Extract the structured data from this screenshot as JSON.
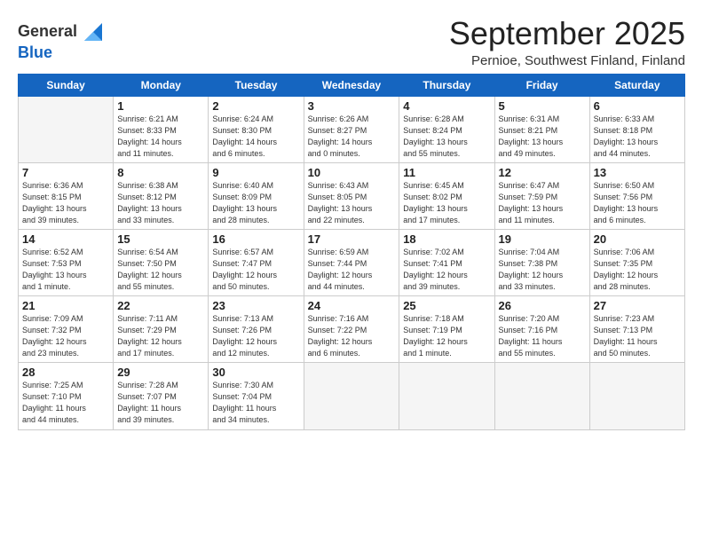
{
  "header": {
    "logo_general": "General",
    "logo_blue": "Blue",
    "month_title": "September 2025",
    "location": "Pernioe, Southwest Finland, Finland"
  },
  "days_of_week": [
    "Sunday",
    "Monday",
    "Tuesday",
    "Wednesday",
    "Thursday",
    "Friday",
    "Saturday"
  ],
  "weeks": [
    [
      {
        "day": "",
        "info": ""
      },
      {
        "day": "1",
        "info": "Sunrise: 6:21 AM\nSunset: 8:33 PM\nDaylight: 14 hours\nand 11 minutes."
      },
      {
        "day": "2",
        "info": "Sunrise: 6:24 AM\nSunset: 8:30 PM\nDaylight: 14 hours\nand 6 minutes."
      },
      {
        "day": "3",
        "info": "Sunrise: 6:26 AM\nSunset: 8:27 PM\nDaylight: 14 hours\nand 0 minutes."
      },
      {
        "day": "4",
        "info": "Sunrise: 6:28 AM\nSunset: 8:24 PM\nDaylight: 13 hours\nand 55 minutes."
      },
      {
        "day": "5",
        "info": "Sunrise: 6:31 AM\nSunset: 8:21 PM\nDaylight: 13 hours\nand 49 minutes."
      },
      {
        "day": "6",
        "info": "Sunrise: 6:33 AM\nSunset: 8:18 PM\nDaylight: 13 hours\nand 44 minutes."
      }
    ],
    [
      {
        "day": "7",
        "info": "Sunrise: 6:36 AM\nSunset: 8:15 PM\nDaylight: 13 hours\nand 39 minutes."
      },
      {
        "day": "8",
        "info": "Sunrise: 6:38 AM\nSunset: 8:12 PM\nDaylight: 13 hours\nand 33 minutes."
      },
      {
        "day": "9",
        "info": "Sunrise: 6:40 AM\nSunset: 8:09 PM\nDaylight: 13 hours\nand 28 minutes."
      },
      {
        "day": "10",
        "info": "Sunrise: 6:43 AM\nSunset: 8:05 PM\nDaylight: 13 hours\nand 22 minutes."
      },
      {
        "day": "11",
        "info": "Sunrise: 6:45 AM\nSunset: 8:02 PM\nDaylight: 13 hours\nand 17 minutes."
      },
      {
        "day": "12",
        "info": "Sunrise: 6:47 AM\nSunset: 7:59 PM\nDaylight: 13 hours\nand 11 minutes."
      },
      {
        "day": "13",
        "info": "Sunrise: 6:50 AM\nSunset: 7:56 PM\nDaylight: 13 hours\nand 6 minutes."
      }
    ],
    [
      {
        "day": "14",
        "info": "Sunrise: 6:52 AM\nSunset: 7:53 PM\nDaylight: 13 hours\nand 1 minute."
      },
      {
        "day": "15",
        "info": "Sunrise: 6:54 AM\nSunset: 7:50 PM\nDaylight: 12 hours\nand 55 minutes."
      },
      {
        "day": "16",
        "info": "Sunrise: 6:57 AM\nSunset: 7:47 PM\nDaylight: 12 hours\nand 50 minutes."
      },
      {
        "day": "17",
        "info": "Sunrise: 6:59 AM\nSunset: 7:44 PM\nDaylight: 12 hours\nand 44 minutes."
      },
      {
        "day": "18",
        "info": "Sunrise: 7:02 AM\nSunset: 7:41 PM\nDaylight: 12 hours\nand 39 minutes."
      },
      {
        "day": "19",
        "info": "Sunrise: 7:04 AM\nSunset: 7:38 PM\nDaylight: 12 hours\nand 33 minutes."
      },
      {
        "day": "20",
        "info": "Sunrise: 7:06 AM\nSunset: 7:35 PM\nDaylight: 12 hours\nand 28 minutes."
      }
    ],
    [
      {
        "day": "21",
        "info": "Sunrise: 7:09 AM\nSunset: 7:32 PM\nDaylight: 12 hours\nand 23 minutes."
      },
      {
        "day": "22",
        "info": "Sunrise: 7:11 AM\nSunset: 7:29 PM\nDaylight: 12 hours\nand 17 minutes."
      },
      {
        "day": "23",
        "info": "Sunrise: 7:13 AM\nSunset: 7:26 PM\nDaylight: 12 hours\nand 12 minutes."
      },
      {
        "day": "24",
        "info": "Sunrise: 7:16 AM\nSunset: 7:22 PM\nDaylight: 12 hours\nand 6 minutes."
      },
      {
        "day": "25",
        "info": "Sunrise: 7:18 AM\nSunset: 7:19 PM\nDaylight: 12 hours\nand 1 minute."
      },
      {
        "day": "26",
        "info": "Sunrise: 7:20 AM\nSunset: 7:16 PM\nDaylight: 11 hours\nand 55 minutes."
      },
      {
        "day": "27",
        "info": "Sunrise: 7:23 AM\nSunset: 7:13 PM\nDaylight: 11 hours\nand 50 minutes."
      }
    ],
    [
      {
        "day": "28",
        "info": "Sunrise: 7:25 AM\nSunset: 7:10 PM\nDaylight: 11 hours\nand 44 minutes."
      },
      {
        "day": "29",
        "info": "Sunrise: 7:28 AM\nSunset: 7:07 PM\nDaylight: 11 hours\nand 39 minutes."
      },
      {
        "day": "30",
        "info": "Sunrise: 7:30 AM\nSunset: 7:04 PM\nDaylight: 11 hours\nand 34 minutes."
      },
      {
        "day": "",
        "info": ""
      },
      {
        "day": "",
        "info": ""
      },
      {
        "day": "",
        "info": ""
      },
      {
        "day": "",
        "info": ""
      }
    ]
  ]
}
